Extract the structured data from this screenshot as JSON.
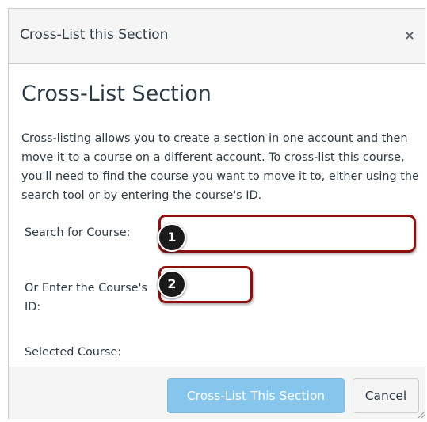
{
  "dialog": {
    "title": "Cross-List this Section",
    "close_label": "×"
  },
  "content": {
    "heading": "Cross-List Section",
    "description": "Cross-listing allows you to create a section in one account and then move it to a course on a different account. To cross-list this course, you'll need to find the course you want to move it to, either using the search tool or by entering the course's ID.",
    "search_label": "Search for Course:",
    "search_value": "",
    "id_label": "Or Enter the Course's ID:",
    "id_value": "",
    "selected_label": "Selected Course:"
  },
  "callouts": {
    "one": "1",
    "two": "2"
  },
  "footer": {
    "primary_label": "Cross-List This Section",
    "cancel_label": "Cancel"
  },
  "colors": {
    "highlight_border": "#8c1010",
    "primary_button": "#86c6ec",
    "titlebar_bg": "#f5f5f5"
  }
}
